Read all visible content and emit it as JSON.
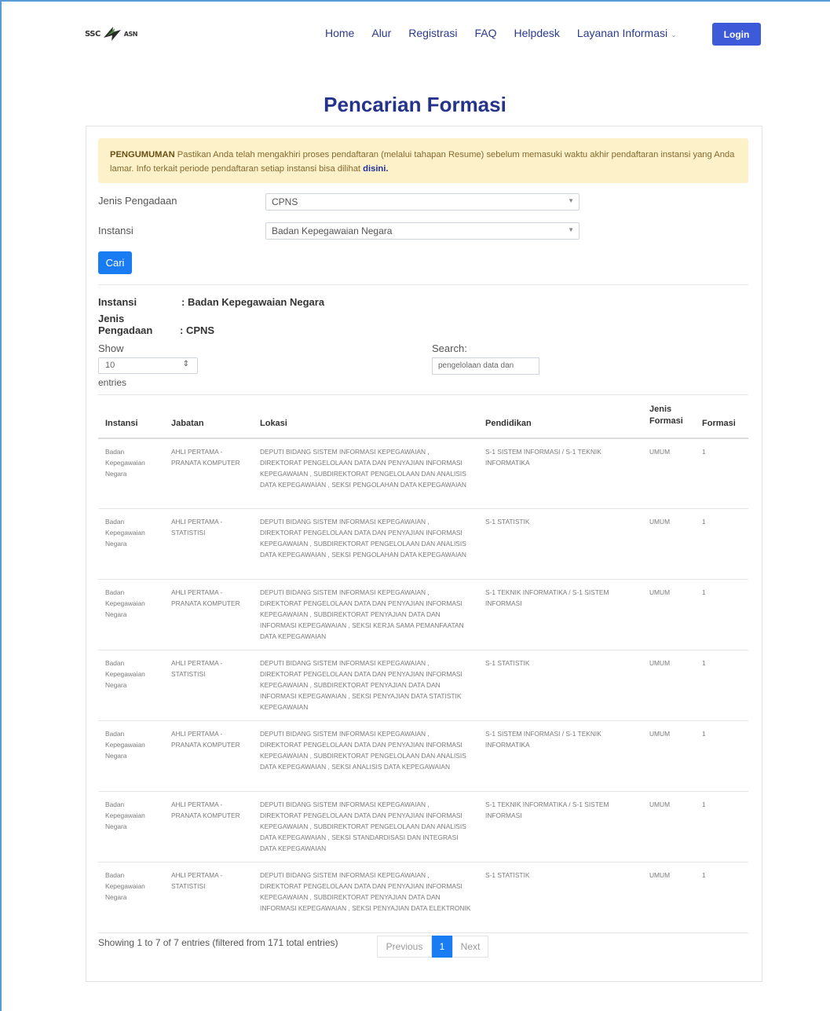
{
  "nav": {
    "logo_text": "SSC",
    "logo_sub": "ASN",
    "links": [
      "Home",
      "Alur",
      "Registrasi",
      "FAQ",
      "Helpdesk",
      "Layanan Informasi"
    ],
    "login": "Login"
  },
  "page": {
    "title": "Pencarian Formasi"
  },
  "announcement": {
    "head": "PENGUMUMAN",
    "text": " Pastikan Anda telah mengakhiri proses pendaftaran (melalui tahapan Resume) sebelum memasuki waktu akhir pendaftaran instansi yang Anda lamar. Info terkait periode pendaftaran setiap instansi bisa dilihat ",
    "link": "disini."
  },
  "form": {
    "jenis_label": "Jenis Pengadaan",
    "jenis_value": "CPNS",
    "instansi_label": "Instansi",
    "instansi_value": "Badan Kepegawaian Negara",
    "cari": "Cari"
  },
  "summary": {
    "instansi_key": "Instansi",
    "instansi_val": ": Badan Kepegawaian Negara",
    "jenis_key": "Jenis Pengadaan",
    "jenis_val": ": CPNS"
  },
  "table_controls": {
    "show": "Show",
    "length": "10",
    "entries": "entries",
    "search_label": "Search:",
    "search_value": "pengelolaan data dan"
  },
  "table": {
    "headers": [
      "Instansi",
      "Jabatan",
      "Lokasi",
      "Pendidikan",
      "Jenis Formasi",
      "Formasi"
    ],
    "rows": [
      {
        "instansi": "Badan Kepegawaian Negara",
        "jabatan": "AHLI PERTAMA - PRANATA KOMPUTER",
        "lokasi": "DEPUTI BIDANG SISTEM INFORMASI KEPEGAWAIAN , DIREKTORAT PENGELOLAAN DATA DAN PENYAJIAN INFORMASI KEPEGAWAIAN , SUBDIREKTORAT PENGELOLAAN DAN ANALISIS DATA KEPEGAWAIAN , SEKSI PENGOLAHAN DATA KEPEGAWAIAN",
        "pendidikan": "S-1 SISTEM INFORMASI / S-1 TEKNIK INFORMATIKA",
        "jenis": "UMUM",
        "formasi": "1"
      },
      {
        "instansi": "Badan Kepegawaian Negara",
        "jabatan": "AHLI PERTAMA - STATISTISI",
        "lokasi": "DEPUTI BIDANG SISTEM INFORMASI KEPEGAWAIAN , DIREKTORAT PENGELOLAAN DATA DAN PENYAJIAN INFORMASI KEPEGAWAIAN , SUBDIREKTORAT PENGELOLAAN DAN ANALISIS DATA KEPEGAWAIAN , SEKSI PENGOLAHAN DATA KEPEGAWAIAN",
        "pendidikan": "S-1 STATISTIK",
        "jenis": "UMUM",
        "formasi": "1"
      },
      {
        "instansi": "Badan Kepegawaian Negara",
        "jabatan": "AHLI PERTAMA - PRANATA KOMPUTER",
        "lokasi": "DEPUTI BIDANG SISTEM INFORMASI KEPEGAWAIAN , DIREKTORAT PENGELOLAAN DATA DAN PENYAJIAN INFORMASI KEPEGAWAIAN , SUBDIREKTORAT PENYAJIAN DATA DAN INFORMASI KEPEGAWAIAN , SEKSI KERJA SAMA PEMANFAATAN DATA KEPEGAWAIAN",
        "pendidikan": "S-1 TEKNIK INFORMATIKA / S-1 SISTEM INFORMASI",
        "jenis": "UMUM",
        "formasi": "1"
      },
      {
        "instansi": "Badan Kepegawaian Negara",
        "jabatan": "AHLI PERTAMA - STATISTISI",
        "lokasi": "DEPUTI BIDANG SISTEM INFORMASI KEPEGAWAIAN , DIREKTORAT PENGELOLAAN DATA DAN PENYAJIAN INFORMASI KEPEGAWAIAN , SUBDIREKTORAT PENYAJIAN DATA DAN INFORMASI KEPEGAWAIAN , SEKSI PENYAJIAN DATA STATISTIK KEPEGAWAIAN",
        "pendidikan": "S-1 STATISTIK",
        "jenis": "UMUM",
        "formasi": "1"
      },
      {
        "instansi": "Badan Kepegawaian Negara",
        "jabatan": "AHLI PERTAMA - PRANATA KOMPUTER",
        "lokasi": "DEPUTI BIDANG SISTEM INFORMASI KEPEGAWAIAN , DIREKTORAT PENGELOLAAN DATA DAN PENYAJIAN INFORMASI KEPEGAWAIAN , SUBDIREKTORAT PENGELOLAAN DAN ANALISIS DATA KEPEGAWAIAN , SEKSI ANALISIS DATA KEPEGAWAIAN",
        "pendidikan": "S-1 SISTEM INFORMASI / S-1 TEKNIK INFORMATIKA",
        "jenis": "UMUM",
        "formasi": "1"
      },
      {
        "instansi": "Badan Kepegawaian Negara",
        "jabatan": "AHLI PERTAMA - PRANATA KOMPUTER",
        "lokasi": "DEPUTI BIDANG SISTEM INFORMASI KEPEGAWAIAN , DIREKTORAT PENGELOLAAN DATA DAN PENYAJIAN INFORMASI KEPEGAWAIAN , SUBDIREKTORAT PENGELOLAAN DAN ANALISIS DATA KEPEGAWAIAN , SEKSI STANDARDISASI DAN INTEGRASI DATA KEPEGAWAIAN",
        "pendidikan": "S-1 TEKNIK INFORMATIKA / S-1 SISTEM INFORMASI",
        "jenis": "UMUM",
        "formasi": "1"
      },
      {
        "instansi": "Badan Kepegawaian Negara",
        "jabatan": "AHLI PERTAMA - STATISTISI",
        "lokasi": "DEPUTI BIDANG SISTEM INFORMASI KEPEGAWAIAN , DIREKTORAT PENGELOLAAN DATA DAN PENYAJIAN INFORMASI KEPEGAWAIAN , SUBDIREKTORAT PENYAJIAN DATA DAN INFORMASI KEPEGAWAIAN , SEKSI PENYAJIAN DATA ELEKTRONIK",
        "pendidikan": "S-1 STATISTIK",
        "jenis": "UMUM",
        "formasi": "1"
      }
    ]
  },
  "footer": {
    "info": "Showing 1 to 7 of 7 entries (filtered from 171 total entries)",
    "previous": "Previous",
    "page": "1",
    "next": "Next"
  }
}
